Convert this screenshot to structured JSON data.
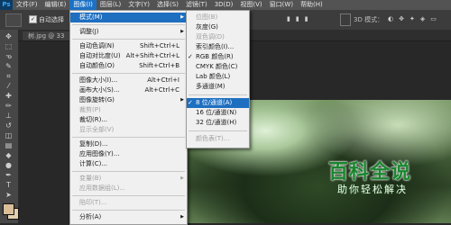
{
  "app": {
    "logo": "Ps"
  },
  "menubar": {
    "items": [
      "文件(F)",
      "编辑(E)",
      "图像(I)",
      "图层(L)",
      "文字(Y)",
      "选择(S)",
      "滤镜(T)",
      "3D(D)",
      "视图(V)",
      "窗口(W)",
      "帮助(H)"
    ],
    "active_index": 2
  },
  "options": {
    "auto_select_label": "自动选择",
    "auto_select_checked": "✓",
    "mode3d_label": "3D 模式："
  },
  "document": {
    "tab_title": "树.jpg @ 33"
  },
  "image_menu": {
    "items": [
      {
        "label": "模式(M)",
        "shortcut": "",
        "submenu": true,
        "state": "highlighted"
      },
      {
        "label": "调整(J)",
        "shortcut": "",
        "submenu": true,
        "state": "normal"
      },
      {
        "label": "自动色调(N)",
        "shortcut": "Shift+Ctrl+L",
        "submenu": false,
        "state": "normal"
      },
      {
        "label": "自动对比度(U)",
        "shortcut": "Alt+Shift+Ctrl+L",
        "submenu": false,
        "state": "normal"
      },
      {
        "label": "自动颜色(O)",
        "shortcut": "Shift+Ctrl+B",
        "submenu": false,
        "state": "normal"
      },
      {
        "label": "图像大小(I)...",
        "shortcut": "Alt+Ctrl+I",
        "submenu": false,
        "state": "normal"
      },
      {
        "label": "画布大小(S)...",
        "shortcut": "Alt+Ctrl+C",
        "submenu": false,
        "state": "normal"
      },
      {
        "label": "图像旋转(G)",
        "shortcut": "",
        "submenu": true,
        "state": "normal"
      },
      {
        "label": "裁剪(P)",
        "shortcut": "",
        "submenu": false,
        "state": "disabled"
      },
      {
        "label": "裁切(R)...",
        "shortcut": "",
        "submenu": false,
        "state": "normal"
      },
      {
        "label": "显示全部(V)",
        "shortcut": "",
        "submenu": false,
        "state": "disabled"
      },
      {
        "label": "复制(D)...",
        "shortcut": "",
        "submenu": false,
        "state": "normal"
      },
      {
        "label": "应用图像(Y)...",
        "shortcut": "",
        "submenu": false,
        "state": "normal"
      },
      {
        "label": "计算(C)...",
        "shortcut": "",
        "submenu": false,
        "state": "normal"
      },
      {
        "label": "变量(B)",
        "shortcut": "",
        "submenu": true,
        "state": "disabled"
      },
      {
        "label": "应用数据组(L)...",
        "shortcut": "",
        "submenu": false,
        "state": "disabled"
      },
      {
        "label": "陷印(T)...",
        "shortcut": "",
        "submenu": false,
        "state": "disabled"
      },
      {
        "label": "分析(A)",
        "shortcut": "",
        "submenu": true,
        "state": "normal"
      }
    ]
  },
  "mode_submenu": {
    "items": [
      {
        "label": "位图(B)",
        "checked": false,
        "state": "disabled"
      },
      {
        "label": "灰度(G)",
        "checked": false,
        "state": "normal"
      },
      {
        "label": "双色调(D)",
        "checked": false,
        "state": "disabled"
      },
      {
        "label": "索引颜色(I)...",
        "checked": false,
        "state": "normal"
      },
      {
        "label": "RGB 颜色(R)",
        "checked": true,
        "state": "normal"
      },
      {
        "label": "CMYK 颜色(C)",
        "checked": false,
        "state": "normal"
      },
      {
        "label": "Lab 颜色(L)",
        "checked": false,
        "state": "normal"
      },
      {
        "label": "多通道(M)",
        "checked": false,
        "state": "normal"
      },
      {
        "label": "8 位/通道(A)",
        "checked": true,
        "state": "highlighted"
      },
      {
        "label": "16 位/通道(N)",
        "checked": false,
        "state": "normal"
      },
      {
        "label": "32 位/通道(H)",
        "checked": false,
        "state": "normal"
      },
      {
        "label": "颜色表(T)...",
        "checked": false,
        "state": "disabled"
      }
    ]
  },
  "watermark": {
    "title": "百科全说",
    "subtitle": "助你轻松解决"
  },
  "colors": {
    "highlight": "#1e6fc0",
    "foreground_swatch": "#d9be98",
    "background_swatch": "#e4cfae"
  },
  "tools": [
    "move-icon",
    "marquee-icon",
    "lasso-icon",
    "quick-select-icon",
    "crop-icon",
    "eyedropper-icon",
    "healing-icon",
    "brush-icon",
    "stamp-icon",
    "history-brush-icon",
    "eraser-icon",
    "gradient-icon",
    "blur-icon",
    "dodge-icon",
    "pen-icon",
    "type-icon",
    "path-select-icon",
    "shape-icon",
    "hand-icon",
    "zoom-icon"
  ]
}
